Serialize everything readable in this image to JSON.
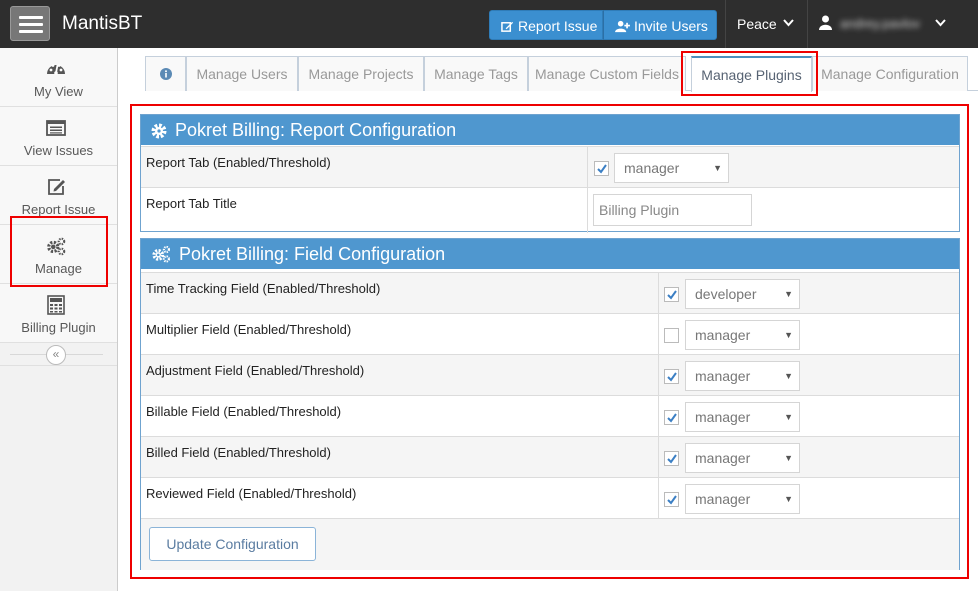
{
  "navbar": {
    "brand": "MantisBT",
    "report_issue": "Report Issue",
    "invite_users": "Invite Users",
    "project": "Peace",
    "user": "andrey.pavlov"
  },
  "sidebar": {
    "items": [
      {
        "label": "My View",
        "icon": "dashboard-icon"
      },
      {
        "label": "View Issues",
        "icon": "list-icon"
      },
      {
        "label": "Report Issue",
        "icon": "edit-icon"
      },
      {
        "label": "Manage",
        "icon": "gears-icon"
      },
      {
        "label": "Billing Plugin",
        "icon": "calculator-icon"
      }
    ]
  },
  "tabs": [
    {
      "label": "Manage Users"
    },
    {
      "label": "Manage Projects"
    },
    {
      "label": "Manage Tags"
    },
    {
      "label": "Manage Custom Fields"
    },
    {
      "label": "Manage Plugins",
      "active": true
    },
    {
      "label": "Manage Configuration"
    }
  ],
  "report_config": {
    "title": "Pokret Billing: Report Configuration",
    "rows": [
      {
        "label": "Report Tab (Enabled/Threshold)",
        "checked": true,
        "value": "manager"
      },
      {
        "label": "Report Tab Title",
        "value": "Billing Plugin"
      }
    ]
  },
  "field_config": {
    "title": "Pokret Billing: Field Configuration",
    "rows": [
      {
        "label": "Time Tracking Field (Enabled/Threshold)",
        "checked": true,
        "value": "developer"
      },
      {
        "label": "Multiplier Field (Enabled/Threshold)",
        "checked": false,
        "value": "manager"
      },
      {
        "label": "Adjustment Field (Enabled/Threshold)",
        "checked": true,
        "value": "manager"
      },
      {
        "label": "Billable Field (Enabled/Threshold)",
        "checked": true,
        "value": "manager"
      },
      {
        "label": "Billed Field (Enabled/Threshold)",
        "checked": true,
        "value": "manager"
      },
      {
        "label": "Reviewed Field (Enabled/Threshold)",
        "checked": true,
        "value": "manager"
      }
    ],
    "update_button": "Update Configuration"
  },
  "colors": {
    "navbar": "#2e2e2e",
    "primary": "#3b8fd0",
    "widget_header": "#4f97cf",
    "highlight": "#ee0000"
  }
}
